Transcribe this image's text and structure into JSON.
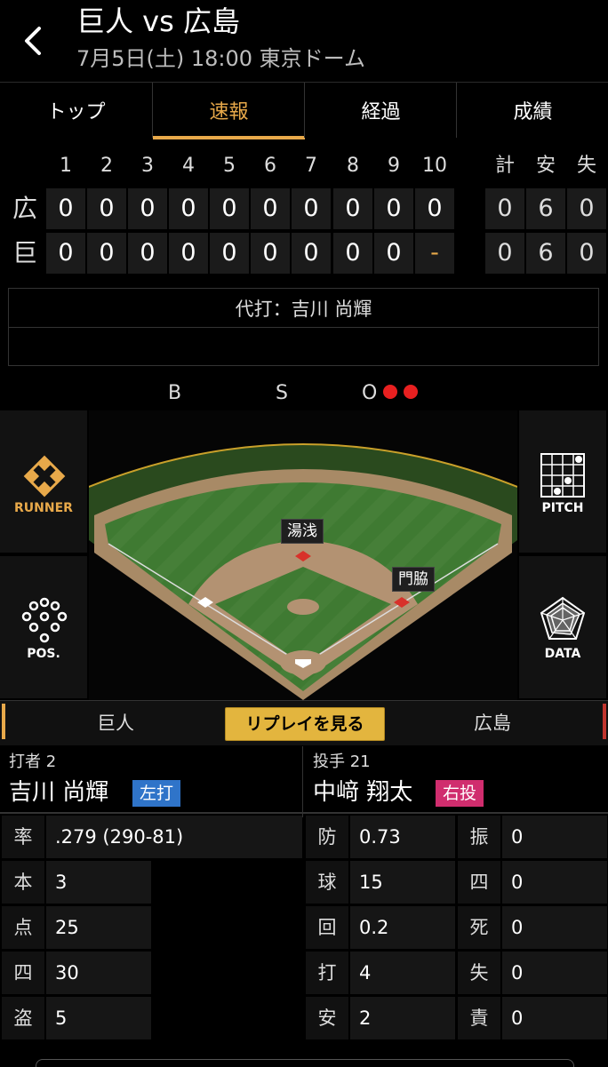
{
  "header": {
    "title": "巨人 vs 広島",
    "subtitle": "7月5日(土) 18:00 東京ドーム"
  },
  "tabs": [
    {
      "label": "トップ"
    },
    {
      "label": "速報"
    },
    {
      "label": "経過"
    },
    {
      "label": "成績"
    }
  ],
  "scoreboard": {
    "innings": [
      "1",
      "2",
      "3",
      "4",
      "5",
      "6",
      "7",
      "8",
      "9",
      "10"
    ],
    "total_headers": [
      "計",
      "安",
      "失"
    ],
    "rows": [
      {
        "team": "広",
        "scores": [
          "0",
          "0",
          "0",
          "0",
          "0",
          "0",
          "0",
          "0",
          "0",
          "0"
        ],
        "totals": [
          "0",
          "6",
          "0"
        ]
      },
      {
        "team": "巨",
        "scores": [
          "0",
          "0",
          "0",
          "0",
          "0",
          "0",
          "0",
          "0",
          "0",
          "-"
        ],
        "totals": [
          "0",
          "6",
          "0"
        ]
      }
    ]
  },
  "message": "代打：吉川 尚輝",
  "count": {
    "b_label": "B",
    "s_label": "S",
    "o_label": "O",
    "balls": 0,
    "strikes": 0,
    "outs": 2
  },
  "side_buttons": {
    "runner": "RUNNER",
    "pitch": "PITCH",
    "pos": "POS.",
    "data": "DATA"
  },
  "field": {
    "runner_second": "湯浅",
    "runner_first": "門脇"
  },
  "strip": {
    "team_left": "巨人",
    "team_right": "広島",
    "replay": "リプレイを見る"
  },
  "batter": {
    "role": "打者 2",
    "name": "吉川 尚輝",
    "hand": "左打",
    "stats": [
      {
        "k": "率",
        "v": ".279 (290-81)"
      },
      {
        "k": "本",
        "v": "3"
      },
      {
        "k": "点",
        "v": "25"
      },
      {
        "k": "四",
        "v": "30"
      },
      {
        "k": "盗",
        "v": "5"
      }
    ]
  },
  "pitcher": {
    "role": "投手 21",
    "name": "中﨑 翔太",
    "hand": "右投",
    "stats_left": [
      {
        "k": "防",
        "v": "0.73"
      },
      {
        "k": "球",
        "v": "15"
      },
      {
        "k": "回",
        "v": "0.2"
      },
      {
        "k": "打",
        "v": "4"
      },
      {
        "k": "安",
        "v": "2"
      }
    ],
    "stats_right": [
      {
        "k": "振",
        "v": "0"
      },
      {
        "k": "四",
        "v": "0"
      },
      {
        "k": "死",
        "v": "0"
      },
      {
        "k": "失",
        "v": "0"
      },
      {
        "k": "責",
        "v": "0"
      }
    ]
  },
  "colors": {
    "accent": "#e8a94a",
    "out_dot": "#e82020",
    "left_badge": "#2f74c9",
    "right_badge": "#d02d6e",
    "grass": "#3f7a32",
    "dirt": "#b39272",
    "replay_button": "#e3b53e"
  }
}
